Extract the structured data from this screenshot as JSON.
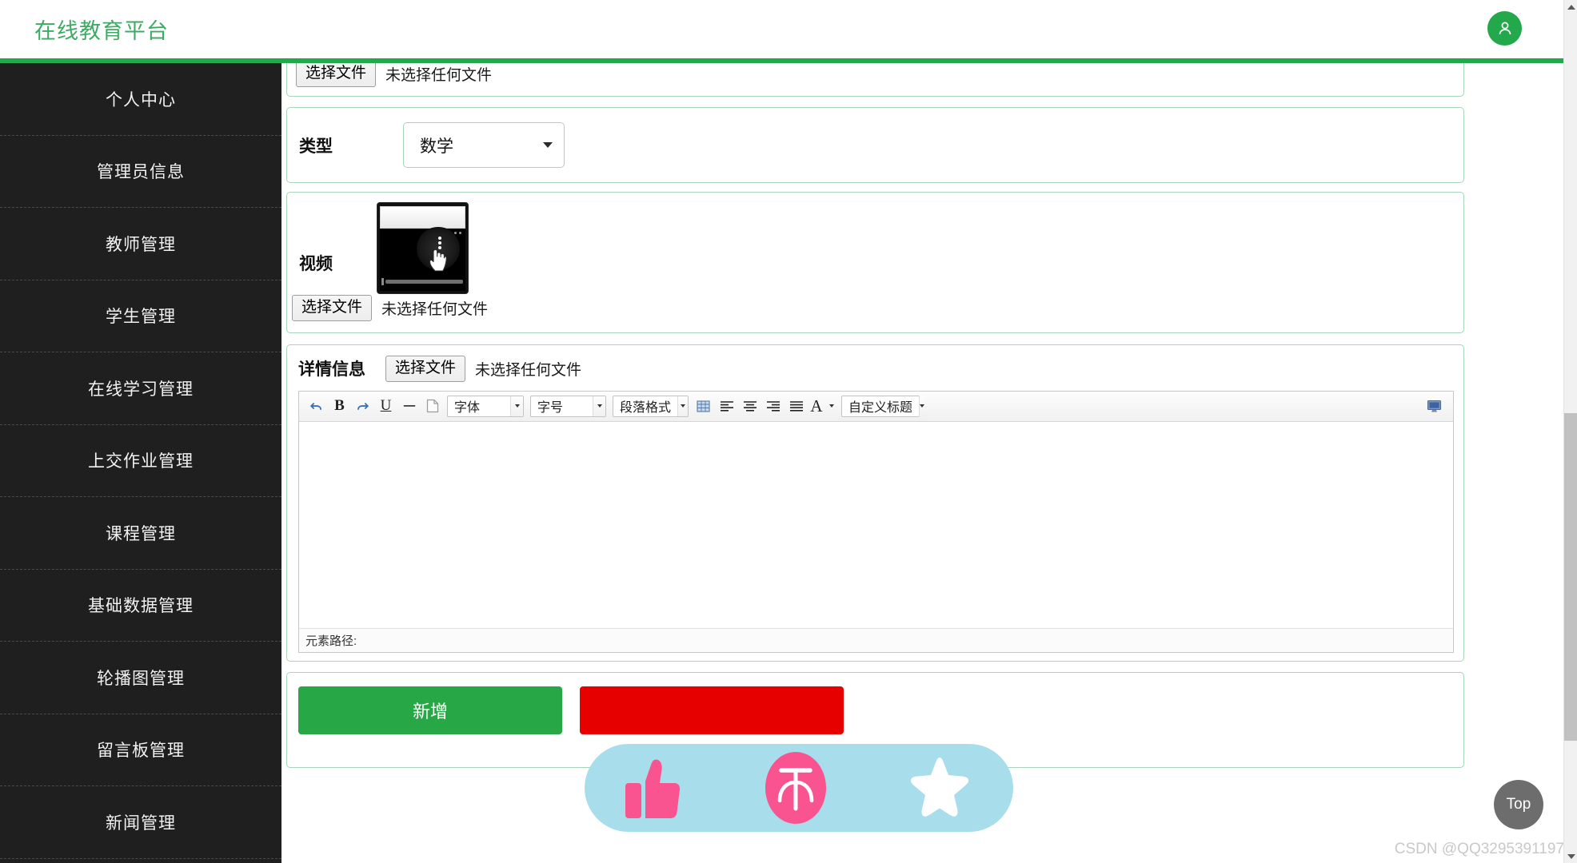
{
  "header": {
    "brand": "在线教育平台",
    "avatar_icon": "user-icon"
  },
  "sidebar": {
    "items": [
      {
        "label": "个人中心"
      },
      {
        "label": "管理员信息"
      },
      {
        "label": "教师管理"
      },
      {
        "label": "学生管理"
      },
      {
        "label": "在线学习管理"
      },
      {
        "label": "上交作业管理"
      },
      {
        "label": "课程管理"
      },
      {
        "label": "基础数据管理"
      },
      {
        "label": "轮播图管理"
      },
      {
        "label": "留言板管理"
      },
      {
        "label": "新闻管理"
      }
    ]
  },
  "form": {
    "upload_top": {
      "button_label": "选择文件",
      "status_text": "未选择任何文件"
    },
    "type_row": {
      "label": "类型",
      "selected": "数学",
      "options": [
        "数学"
      ]
    },
    "video_row": {
      "label": "视频",
      "button_label": "选择文件",
      "status_text": "未选择任何文件",
      "thumbnail_alt": "video-thumbnail"
    },
    "detail_row": {
      "label": "详情信息",
      "button_label": "选择文件",
      "status_text": "未选择任何文件"
    }
  },
  "editor": {
    "toolbar": {
      "undo_icon": "undo-icon",
      "bold_label": "B",
      "redo_icon": "redo-icon",
      "underline_label": "U",
      "hr_icon": "horizontal-rule-icon",
      "page_icon": "page-icon",
      "font_family": "字体",
      "font_size": "字号",
      "paragraph_format": "段落格式",
      "table_icon": "table-icon",
      "align_left_icon": "align-left-icon",
      "align_center_icon": "align-center-icon",
      "align_right_icon": "align-right-icon",
      "align_justify_icon": "align-justify-icon",
      "font_color_label": "A",
      "custom_title": "自定义标题",
      "fullscreen_icon": "monitor-icon"
    },
    "content": "",
    "status_label": "元素路径:"
  },
  "actions": {
    "submit_label": "新增",
    "reset_label": ""
  },
  "reactions": {
    "thumbs_up_icon": "thumbs-up-icon",
    "reward_icon": "reward-icon",
    "star_icon": "star-icon"
  },
  "floating": {
    "top_button_label": "Top"
  },
  "watermark": {
    "text": "CSDN @QQ3295391197"
  },
  "colors": {
    "brand_green": "#3eaa63",
    "header_rule": "#24a84c",
    "sidebar_bg": "#1f1f1f",
    "panel_border": "#a8d5b9",
    "submit_green": "#27a745",
    "reset_red": "#e60000",
    "reaction_bg": "#a8ddeb",
    "reaction_pink": "#f9548f"
  }
}
